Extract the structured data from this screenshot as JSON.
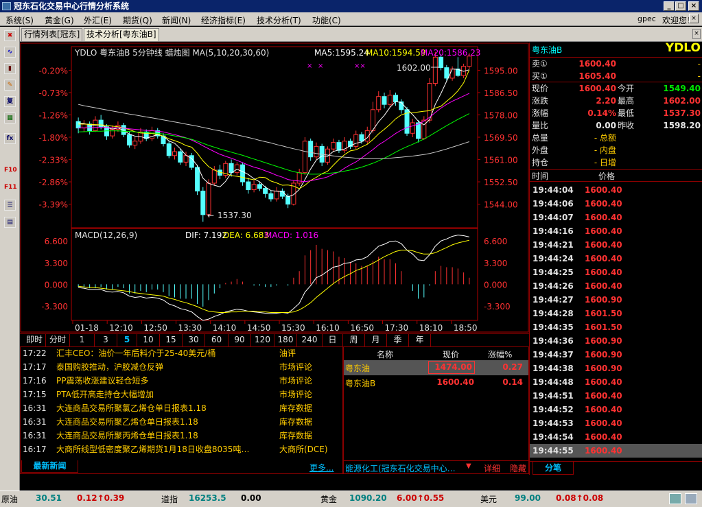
{
  "window": {
    "title": "冠东石化交易中心行情分析系统",
    "user": "gpec",
    "welcome": "欢迎您！",
    "buttons": [
      "_",
      "□",
      "×"
    ]
  },
  "menu": [
    "系统(S)",
    "黄金(G)",
    "外汇(E)",
    "期货(Q)",
    "新闻(N)",
    "经济指标(E)",
    "技术分析(T)",
    "功能(C)"
  ],
  "tabs": [
    "行情列表[冠东]",
    "技术分析[粤东油B]"
  ],
  "left_toolbar": [
    "close-icon",
    "line-chart-icon",
    "candle-icon",
    "pen-icon",
    "copy-icon",
    "grid-icon",
    "formula-icon",
    "F10",
    "F11",
    "list-icon",
    "note-icon"
  ],
  "chart_header": {
    "symbol": "YDLO 粤东油B 5分钟线  蜡烛图 MA(5,10,20,30,60)",
    "ma5": "MA5:1595.24",
    "ma10": "MA10:1594.59",
    "ma20": "MA20:1586.23",
    "high_mark": "1602.00",
    "low_mark": "1537.30",
    "markers": [
      "×",
      "×",
      "××"
    ]
  },
  "macd_header": {
    "title": "MACD(12,26,9)",
    "dif": "DIF: 7.192",
    "dea": "DEA: 6.683",
    "macd": "MACD: 1.016"
  },
  "periods": [
    "即时",
    "分时",
    "1",
    "3",
    "5",
    "10",
    "15",
    "30",
    "60",
    "90",
    "120",
    "180",
    "240",
    "日",
    "周",
    "月",
    "季",
    "年"
  ],
  "selected_period": "5",
  "news": [
    {
      "time": "17:22",
      "headline": "汇丰CEO：油价一年后料介于25-40美元/桶",
      "cat": "油评"
    },
    {
      "time": "17:17",
      "headline": "泰国购胶推动，沪胶减仓反弹",
      "cat": "市场评论"
    },
    {
      "time": "17:16",
      "headline": "PP震荡收涨建议轻仓短多",
      "cat": "市场评论"
    },
    {
      "time": "17:15",
      "headline": "PTA低开高走持仓大幅增加",
      "cat": "市场评论"
    },
    {
      "time": "16:31",
      "headline": "大连商品交易所聚氯乙烯仓单日报表1.18",
      "cat": "库存数据"
    },
    {
      "time": "16:31",
      "headline": "大连商品交易所聚乙烯仓单日报表1.18",
      "cat": "库存数据"
    },
    {
      "time": "16:31",
      "headline": "大连商品交易所聚丙烯仓单日报表1.18",
      "cat": "库存数据"
    },
    {
      "time": "16:17",
      "headline": "大商所线型低密度聚乙烯期货1月18日收盘8035吨…",
      "cat": "大商所(DCE)"
    }
  ],
  "news_footer": {
    "tab": "最新新闻",
    "more": "更多..."
  },
  "quotes": {
    "headers": [
      "名称",
      "现价",
      "涨幅%"
    ],
    "rows": [
      {
        "name": "粤东油",
        "price": "1474.00",
        "chg": "0.27"
      },
      {
        "name": "粤东油B",
        "price": "1600.40",
        "chg": "0.14"
      }
    ],
    "footer": "能源化工(冠东石化交易中心…",
    "footer_arrow": "▼",
    "detail": "详细",
    "hide": "隐藏"
  },
  "quote_panel": {
    "name": "粤东油B",
    "code": "YDLO",
    "sell_label": "卖①",
    "sell": "1600.40",
    "buy_label": "买①",
    "buy": "1605.40",
    "rows": [
      [
        "现价",
        "1600.40",
        "今开",
        "1549.40"
      ],
      [
        "涨跌",
        "2.20",
        "最高",
        "1602.00"
      ],
      [
        "涨幅",
        "0.14%",
        "最低",
        "1537.30"
      ],
      [
        "量比",
        "0.00",
        "昨收",
        "1598.20"
      ],
      [
        "总量",
        "- 总额",
        "",
        ""
      ],
      [
        "外盘",
        "- 内盘",
        "",
        ""
      ],
      [
        "持仓",
        "- 日增",
        "",
        ""
      ]
    ],
    "tick_header": [
      "时间",
      "价格"
    ],
    "ticks": [
      [
        "19:44:04",
        "1600.40"
      ],
      [
        "19:44:06",
        "1600.40"
      ],
      [
        "19:44:07",
        "1600.40"
      ],
      [
        "19:44:16",
        "1600.40"
      ],
      [
        "19:44:21",
        "1600.40"
      ],
      [
        "19:44:24",
        "1600.40"
      ],
      [
        "19:44:25",
        "1600.40"
      ],
      [
        "19:44:26",
        "1600.40"
      ],
      [
        "19:44:27",
        "1600.90"
      ],
      [
        "19:44:28",
        "1601.50"
      ],
      [
        "19:44:35",
        "1601.50"
      ],
      [
        "19:44:36",
        "1600.90"
      ],
      [
        "19:44:37",
        "1600.90"
      ],
      [
        "19:44:38",
        "1600.90"
      ],
      [
        "19:44:48",
        "1600.40"
      ],
      [
        "19:44:51",
        "1600.40"
      ],
      [
        "19:44:52",
        "1600.40"
      ],
      [
        "19:44:53",
        "1600.40"
      ],
      [
        "19:44:54",
        "1600.40"
      ],
      [
        "19:44:55",
        "1600.40"
      ]
    ],
    "tick_tab": "分笔"
  },
  "status": [
    {
      "name": "原油",
      "price": "30.51",
      "chg": "0.12↑0.39"
    },
    {
      "name": "道指",
      "price": "16253.5",
      "chg": "0.00"
    },
    {
      "name": "黄金",
      "price": "1090.20",
      "chg": "6.00↑0.55"
    },
    {
      "name": "美元",
      "price": "99.00",
      "chg": "0.08↑0.08"
    }
  ],
  "chart_data": {
    "type": "candlestick",
    "price_axis_left": [
      "-0.20%",
      "-0.73%",
      "-1.26%",
      "-1.80%",
      "-2.33%",
      "-2.86%",
      "-3.39%"
    ],
    "price_axis_right": [
      "1595.00",
      "1586.50",
      "1578.00",
      "1569.50",
      "1561.00",
      "1552.50",
      "1544.00"
    ],
    "price_ylim": [
      1535,
      1604
    ],
    "time_labels": [
      "01-18",
      "12:10",
      "12:50",
      "13:30",
      "14:10",
      "14:50",
      "15:30",
      "16:10",
      "16:50",
      "17:30",
      "18:10",
      "18:50"
    ],
    "macd_axis": [
      "6.600",
      "3.300",
      "0.000",
      "-3.300"
    ],
    "macd_ylim": [
      -5.5,
      8.5
    ],
    "candles": [
      [
        1575.5,
        1573.0,
        1577.0,
        1571.0
      ],
      [
        1573.0,
        1574.5,
        1576.0,
        1571.5
      ],
      [
        1574.5,
        1572.0,
        1575.5,
        1570.5
      ],
      [
        1572.0,
        1576.0,
        1577.5,
        1571.5
      ],
      [
        1576.0,
        1573.5,
        1578.0,
        1572.5
      ],
      [
        1573.5,
        1570.0,
        1574.5,
        1568.5
      ],
      [
        1570.0,
        1572.5,
        1574.0,
        1569.0
      ],
      [
        1572.5,
        1574.0,
        1575.5,
        1571.5
      ],
      [
        1574.0,
        1570.5,
        1575.0,
        1569.5
      ],
      [
        1570.5,
        1566.5,
        1571.5,
        1565.5
      ],
      [
        1566.5,
        1568.0,
        1569.5,
        1565.0
      ],
      [
        1568.0,
        1571.5,
        1573.0,
        1567.0
      ],
      [
        1571.5,
        1569.0,
        1572.5,
        1568.0
      ],
      [
        1569.0,
        1572.0,
        1573.5,
        1568.0
      ],
      [
        1572.0,
        1570.0,
        1573.0,
        1569.0
      ],
      [
        1570.0,
        1567.0,
        1571.0,
        1566.0
      ],
      [
        1567.0,
        1562.5,
        1568.0,
        1561.5
      ],
      [
        1562.5,
        1564.0,
        1565.5,
        1561.0
      ],
      [
        1564.0,
        1560.0,
        1565.0,
        1559.0
      ],
      [
        1560.0,
        1562.5,
        1564.0,
        1558.5
      ],
      [
        1562.5,
        1558.0,
        1563.5,
        1557.0
      ],
      [
        1558.0,
        1549.0,
        1559.0,
        1547.5
      ],
      [
        1549.0,
        1540.0,
        1550.5,
        1537.3
      ],
      [
        1540.0,
        1552.0,
        1553.5,
        1539.0
      ],
      [
        1552.0,
        1557.0,
        1558.5,
        1551.0
      ],
      [
        1557.0,
        1555.0,
        1559.0,
        1553.5
      ],
      [
        1555.0,
        1559.5,
        1560.5,
        1554.0
      ],
      [
        1559.5,
        1556.0,
        1561.0,
        1554.5
      ],
      [
        1556.0,
        1559.0,
        1560.0,
        1555.0
      ],
      [
        1559.0,
        1552.5,
        1560.0,
        1551.0
      ],
      [
        1552.5,
        1549.5,
        1554.0,
        1548.0
      ],
      [
        1549.5,
        1551.5,
        1553.0,
        1548.5
      ],
      [
        1551.5,
        1550.0,
        1552.5,
        1549.0
      ],
      [
        1550.0,
        1548.0,
        1551.0,
        1546.5
      ],
      [
        1548.0,
        1546.0,
        1549.0,
        1545.0
      ],
      [
        1546.0,
        1549.0,
        1550.5,
        1545.0
      ],
      [
        1549.0,
        1547.0,
        1550.0,
        1546.0
      ],
      [
        1547.0,
        1544.0,
        1548.0,
        1542.5
      ],
      [
        1544.0,
        1552.0,
        1553.0,
        1543.5
      ],
      [
        1552.0,
        1556.0,
        1557.5,
        1551.0
      ],
      [
        1556.0,
        1568.0,
        1569.5,
        1555.0
      ],
      [
        1568.0,
        1562.0,
        1569.0,
        1560.5
      ],
      [
        1562.0,
        1566.0,
        1567.5,
        1561.0
      ],
      [
        1566.0,
        1560.0,
        1567.0,
        1558.5
      ],
      [
        1560.0,
        1565.0,
        1566.0,
        1559.0
      ],
      [
        1565.0,
        1567.5,
        1569.0,
        1564.0
      ],
      [
        1567.5,
        1564.5,
        1568.5,
        1563.5
      ],
      [
        1564.5,
        1568.0,
        1569.5,
        1563.5
      ],
      [
        1568.0,
        1566.0,
        1569.0,
        1565.0
      ],
      [
        1566.0,
        1570.5,
        1572.0,
        1565.0
      ],
      [
        1570.5,
        1568.0,
        1571.5,
        1567.0
      ],
      [
        1568.0,
        1572.0,
        1573.5,
        1567.0
      ],
      [
        1572.0,
        1580.0,
        1583.0,
        1571.0
      ],
      [
        1580.0,
        1585.0,
        1587.0,
        1579.0
      ],
      [
        1585.0,
        1582.0,
        1586.5,
        1580.5
      ],
      [
        1582.0,
        1585.5,
        1587.5,
        1581.0
      ],
      [
        1585.5,
        1583.0,
        1586.5,
        1581.5
      ],
      [
        1583.0,
        1580.0,
        1584.0,
        1578.5
      ],
      [
        1580.0,
        1571.0,
        1581.0,
        1570.0
      ],
      [
        1571.0,
        1575.0,
        1576.5,
        1569.5
      ],
      [
        1575.0,
        1569.0,
        1576.0,
        1567.5
      ],
      [
        1569.0,
        1576.0,
        1577.5,
        1568.5
      ],
      [
        1576.0,
        1590.0,
        1592.0,
        1575.0
      ],
      [
        1590.0,
        1600.0,
        1602.0,
        1589.0
      ],
      [
        1600.0,
        1596.0,
        1601.0,
        1595.0
      ],
      [
        1596.0,
        1592.0,
        1597.0,
        1591.0
      ],
      [
        1592.0,
        1595.5,
        1596.5,
        1591.0
      ],
      [
        1595.5,
        1593.0,
        1600.0,
        1592.5
      ],
      [
        1593.0,
        1596.5,
        1597.5,
        1592.0
      ],
      [
        1596.5,
        1600.4,
        1601.5,
        1595.5
      ]
    ],
    "ma5": [
      1575.0,
      1574.7,
      1574.2,
      1574.1,
      1574.2,
      1573.2,
      1572.6,
      1573.0,
      1572.1,
      1570.7,
      1569.9,
      1569.7,
      1569.1,
      1569.8,
      1570.5,
      1569.9,
      1568.1,
      1567.2,
      1565.1,
      1562.6,
      1561.4,
      1558.7,
      1553.9,
      1551.9,
      1551.2,
      1550.6,
      1552.7,
      1555.9,
      1557.3,
      1556.4,
      1555.3,
      1553.7,
      1552.5,
      1550.5,
      1549.2,
      1548.9,
      1548.8,
      1546.8,
      1547.6,
      1549.6,
      1553.4,
      1557.4,
      1560.8,
      1562.4,
      1562.2,
      1564.1,
      1564.6,
      1565.0,
      1566.2,
      1567.2,
      1567.7,
      1569.3,
      1572.3,
      1575.4,
      1577.8,
      1580.9,
      1583.1,
      1582.7,
      1580.3,
      1578.1,
      1575.6,
      1574.2,
      1576.2,
      1582.0,
      1586.2,
      1590.8,
      1595.5,
      1595.3,
      1594.6,
      1595.2
    ],
    "ma10": [
      1574.5,
      1574.5,
      1574.4,
      1574.3,
      1574.2,
      1574.0,
      1573.7,
      1573.5,
      1573.0,
      1572.4,
      1571.6,
      1571.1,
      1571.0,
      1570.9,
      1570.6,
      1569.9,
      1568.9,
      1568.2,
      1567.4,
      1566.3,
      1565.7,
      1563.4,
      1560.5,
      1558.3,
      1557.0,
      1556.1,
      1555.7,
      1554.9,
      1554.6,
      1554.2,
      1553.7,
      1553.3,
      1554.3,
      1554.1,
      1552.8,
      1552.1,
      1551.2,
      1551.3,
      1550.9,
      1549.9,
      1551.2,
      1553.0,
      1554.2,
      1555.6,
      1556.5,
      1558.8,
      1561.0,
      1562.9,
      1564.3,
      1564.7,
      1565.8,
      1566.8,
      1568.6,
      1570.8,
      1572.5,
      1574.4,
      1576.5,
      1578.0,
      1578.7,
      1578.8,
      1579.1,
      1579.4,
      1579.6,
      1580.6,
      1581.3,
      1583.2,
      1585.0,
      1587.2,
      1590.2,
      1595.2
    ],
    "ma20": [
      1573.0,
      1573.1,
      1573.1,
      1573.2,
      1573.2,
      1573.2,
      1573.1,
      1573.1,
      1573.0,
      1572.7,
      1572.5,
      1572.3,
      1572.1,
      1572.0,
      1571.8,
      1571.5,
      1571.0,
      1570.5,
      1569.9,
      1569.3,
      1568.4,
      1567.4,
      1566.2,
      1565.1,
      1564.0,
      1563.0,
      1562.2,
      1561.5,
      1560.7,
      1559.8,
      1558.9,
      1558.1,
      1557.5,
      1556.7,
      1555.9,
      1555.0,
      1554.3,
      1553.4,
      1553.0,
      1552.8,
      1552.6,
      1552.9,
      1553.4,
      1553.8,
      1554.4,
      1555.4,
      1556.3,
      1557.7,
      1559.0,
      1560.1,
      1561.6,
      1563.2,
      1564.8,
      1566.6,
      1567.9,
      1569.4,
      1570.9,
      1572.2,
      1573.2,
      1573.8,
      1574.5,
      1575.6,
      1577.1,
      1578.9,
      1580.6,
      1582.0,
      1583.2,
      1584.2,
      1585.2,
      1586.2
    ],
    "ma30": [
      1571.5,
      1571.6,
      1571.7,
      1571.8,
      1571.8,
      1571.9,
      1571.9,
      1571.9,
      1571.8,
      1571.7,
      1571.5,
      1571.4,
      1571.2,
      1571.1,
      1571.0,
      1570.7,
      1570.4,
      1570.0,
      1569.6,
      1569.2,
      1568.7,
      1568.0,
      1567.2,
      1566.4,
      1565.7,
      1565.0,
      1564.4,
      1563.8,
      1563.2,
      1562.6,
      1561.9,
      1561.2,
      1560.5,
      1559.8,
      1559.1,
      1558.4,
      1557.7,
      1557.0,
      1556.4,
      1555.9,
      1555.6,
      1555.4,
      1555.4,
      1555.5,
      1555.7,
      1555.9,
      1556.2,
      1556.6,
      1557.0,
      1557.5,
      1558.1,
      1558.8,
      1559.6,
      1560.5,
      1561.5,
      1562.6,
      1563.8,
      1564.9,
      1565.9,
      1566.8,
      1567.8,
      1568.8,
      1570.0,
      1571.3,
      1572.6,
      1573.9,
      1575.1,
      1576.3,
      1577.4,
      1578.5
    ],
    "ma60": [
      1582.0,
      1581.5,
      1581.1,
      1580.7,
      1580.3,
      1579.9,
      1579.5,
      1579.1,
      1578.7,
      1578.3,
      1578.0,
      1577.6,
      1577.2,
      1576.9,
      1576.5,
      1576.1,
      1575.7,
      1575.3,
      1574.9,
      1574.5,
      1574.1,
      1573.7,
      1573.2,
      1572.8,
      1572.3,
      1571.9,
      1571.4,
      1570.9,
      1570.4,
      1569.9,
      1569.4,
      1568.9,
      1568.3,
      1567.8,
      1567.3,
      1566.7,
      1566.2,
      1565.6,
      1565.1,
      1564.6,
      1564.1,
      1563.7,
      1563.3,
      1563.0,
      1562.7,
      1562.4,
      1562.1,
      1561.9,
      1561.7,
      1561.5,
      1561.4,
      1561.3,
      1561.3,
      1561.3,
      1561.4,
      1561.5,
      1561.7,
      1561.9,
      1562.1,
      1562.3,
      1562.6,
      1562.9,
      1563.3,
      1563.8,
      1564.4,
      1565.0,
      1565.7,
      1566.4,
      1567.1,
      1567.8
    ],
    "dif": [
      -0.5,
      -0.6,
      -0.8,
      -0.8,
      -0.8,
      -1.1,
      -1.2,
      -1.1,
      -1.3,
      -1.8,
      -2.0,
      -1.9,
      -2.1,
      -2.0,
      -2.1,
      -2.4,
      -3.0,
      -3.3,
      -3.7,
      -3.9,
      -4.2,
      -4.9,
      -5.5,
      -5.3,
      -4.9,
      -4.6,
      -4.2,
      -4.0,
      -3.8,
      -3.9,
      -4.1,
      -4.2,
      -4.3,
      -4.4,
      -4.5,
      -4.4,
      -4.3,
      -4.4,
      -3.7,
      -2.9,
      -1.2,
      -0.2,
      1.0,
      1.4,
      2.0,
      2.6,
      2.8,
      3.2,
      3.3,
      3.7,
      3.8,
      4.2,
      5.0,
      5.8,
      6.1,
      6.5,
      6.6,
      6.2,
      5.2,
      4.6,
      3.7,
      3.6,
      4.5,
      5.8,
      6.6,
      6.9,
      7.3,
      7.5,
      7.4,
      7.2
    ],
    "dea": [
      -0.3,
      -0.4,
      -0.5,
      -0.5,
      -0.6,
      -0.7,
      -0.8,
      -0.9,
      -1.0,
      -1.1,
      -1.3,
      -1.4,
      -1.5,
      -1.6,
      -1.7,
      -1.8,
      -2.1,
      -2.3,
      -2.6,
      -2.8,
      -3.1,
      -3.4,
      -3.8,
      -4.1,
      -4.2,
      -4.3,
      -4.3,
      -4.2,
      -4.2,
      -4.1,
      -4.1,
      -4.1,
      -4.2,
      -4.2,
      -4.3,
      -4.3,
      -4.3,
      -4.3,
      -4.2,
      -3.9,
      -3.4,
      -2.8,
      -2.0,
      -1.3,
      -0.6,
      0.1,
      0.7,
      1.2,
      1.6,
      2.1,
      2.4,
      2.8,
      3.2,
      3.7,
      4.2,
      4.6,
      5.0,
      5.2,
      5.2,
      5.1,
      4.8,
      4.6,
      4.6,
      4.8,
      5.2,
      5.6,
      6.0,
      6.3,
      6.5,
      6.7
    ]
  }
}
